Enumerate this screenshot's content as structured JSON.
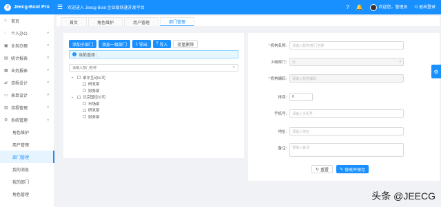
{
  "app": {
    "logo_text": "Jeecg-Boot Pro",
    "welcome": "欢迎进入 Jeecg-Boot 企业级快速开发平台"
  },
  "topbar": {
    "user_text": "欢迎您，管理员",
    "logout_label": "退出登录"
  },
  "sidebar": {
    "items": [
      {
        "icon": "home-icon",
        "label": "首页",
        "arrow": false
      },
      {
        "icon": "user-icon",
        "label": "个人办公",
        "arrow": true
      },
      {
        "icon": "cart-icon",
        "label": "业务办理",
        "arrow": true
      },
      {
        "icon": "chart-icon",
        "label": "统计报表",
        "arrow": true
      },
      {
        "icon": "table-icon",
        "label": "业务报表",
        "arrow": true
      },
      {
        "icon": "flow-icon",
        "label": "流程设计",
        "arrow": true
      },
      {
        "icon": "form-icon",
        "label": "表单设计",
        "arrow": true
      },
      {
        "icon": "manage-icon",
        "label": "流程管理",
        "arrow": true
      },
      {
        "icon": "gear-icon",
        "label": "系统管理",
        "arrow": true
      }
    ],
    "subitems": [
      "角色维护",
      "用户管理",
      "部门管理",
      "我的消息",
      "我的部门",
      "角色管理"
    ],
    "active_sub": "部门管理"
  },
  "tabs": [
    "首页",
    "角色维护",
    "用户管理",
    "部门管理"
  ],
  "active_tab": "部门管理",
  "toolbar": {
    "add_child": "添加子部门",
    "add_top": "添加一级部门",
    "export": "导出",
    "import": "导入",
    "batch_delete": "批量删除"
  },
  "info": {
    "current_selection": "当前选择："
  },
  "tree_search": {
    "placeholder": "请输入部门名称"
  },
  "tree": [
    {
      "label": "卓尔互动公司",
      "children": [
        "研发部",
        "财务部"
      ]
    },
    {
      "label": "北京国炬公司",
      "children": [
        "市场部",
        "研发部",
        "财务部"
      ]
    }
  ],
  "form": {
    "org_name_label": "机构名称:",
    "org_name_placeholder": "请输入机构/部门名称",
    "parent_label": "上级部门:",
    "parent_value": "无",
    "org_code_label": "机构编码:",
    "org_code_placeholder": "请输入机构编码",
    "sort_label": "排序:",
    "sort_value": "0",
    "phone_label": "手机号:",
    "phone_placeholder": "请输入手机号",
    "address_label": "地址:",
    "address_placeholder": "请输入地址",
    "remark_label": "备注:",
    "remark_placeholder": "请输入备注",
    "reset_label": "重置",
    "save_label": "修改并保存"
  },
  "watermark": "头条 @JEECG",
  "colors": {
    "primary": "#1890ff",
    "sidebar_bg": "#ffffff",
    "page_bg": "#f0f2f5"
  }
}
